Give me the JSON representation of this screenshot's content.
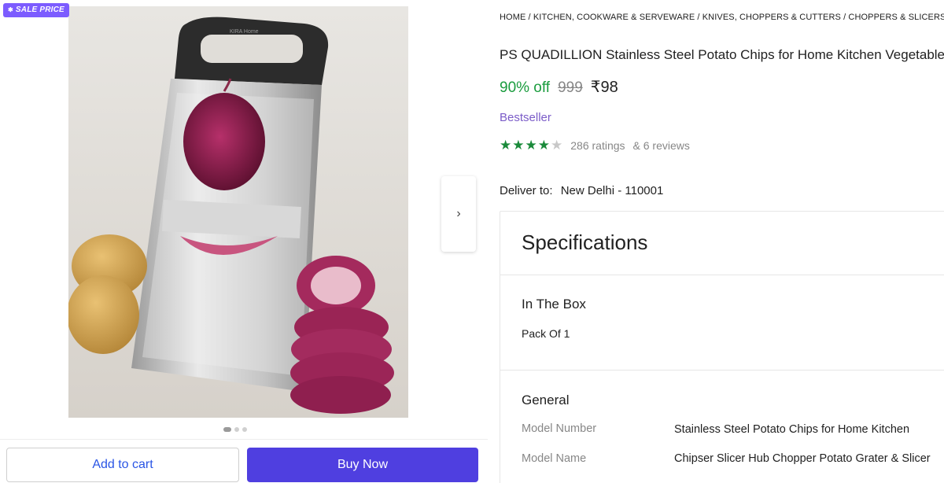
{
  "badge": {
    "label": "SALE PRICE",
    "icon": "sparkle-icon",
    "color": "#7c5cff"
  },
  "gallery": {
    "image_alt": "Stainless steel mandoline slicer with red onion and potatoes",
    "brand_mark": "KIRA Home",
    "next_icon": "chevron-right-icon",
    "slide_count": 3,
    "active_slide": 1
  },
  "actions": {
    "add_to_cart": "Add to cart",
    "buy_now": "Buy Now",
    "buy_color": "#4f3fe0",
    "cart_text_color": "#2a55e5"
  },
  "breadcrumb": "HOME / KITCHEN, COOKWARE & SERVEWARE / KNIVES, CHOPPERS & CUTTERS / CHOPPERS & SLICERS / PS",
  "product": {
    "title": "PS QUADILLION Stainless Steel Potato Chips for Home Kitchen Vegetable",
    "discount": "90% off",
    "mrp": "999",
    "price": "₹98",
    "discount_color": "#1a9c3e",
    "tag": "Bestseller",
    "rating_value": 4,
    "rating_max": 5,
    "ratings_text": "286 ratings",
    "reviews_text": "& 6 reviews"
  },
  "delivery": {
    "label": "Deliver to:",
    "location": "New Delhi - 110001"
  },
  "specifications": {
    "title": "Specifications",
    "in_the_box": {
      "heading": "In The Box",
      "value": "Pack Of 1"
    },
    "general": {
      "heading": "General",
      "rows": [
        {
          "key": "Model Number",
          "value": "Stainless Steel Potato Chips for Home Kitchen"
        },
        {
          "key": "Model Name",
          "value": "Chipser Slicer Hub Chopper Potato Grater & Slicer"
        }
      ]
    }
  }
}
